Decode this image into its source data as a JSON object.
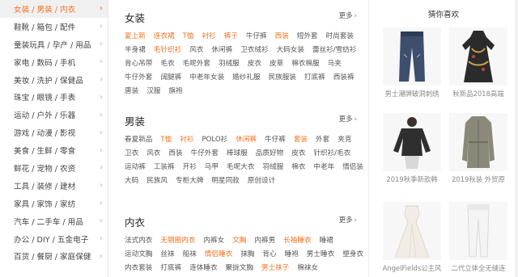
{
  "sidebar": {
    "items": [
      {
        "label": "女装 / 男装 / 内衣",
        "active": true
      },
      {
        "label": "鞋靴 / 箱包 / 配件"
      },
      {
        "label": "童装玩具 / 孕产 / 用品"
      },
      {
        "label": "家电 / 数码 / 手机"
      },
      {
        "label": "美妆 / 洗护 / 保健品"
      },
      {
        "label": "珠宝 / 眼镜 / 手表"
      },
      {
        "label": "运动 / 户外 / 乐器"
      },
      {
        "label": "游戏 / 动漫 / 影视"
      },
      {
        "label": "美食 / 生鲜 / 零食"
      },
      {
        "label": "鲜花 / 宠物 / 农资"
      },
      {
        "label": "工具 / 装修 / 建材"
      },
      {
        "label": "家具 / 家饰 / 家纺"
      },
      {
        "label": "汽车 / 二手车 / 用品"
      },
      {
        "label": "办公 / DIY / 五金电子"
      },
      {
        "label": "百货 / 餐厨 / 家庭保健"
      }
    ],
    "chevron": "›"
  },
  "sections": [
    {
      "title": "女装",
      "more": "更多",
      "tags": [
        {
          "t": "夏上新",
          "hot": true
        },
        {
          "t": "连衣裙",
          "hot": true
        },
        {
          "t": "T恤",
          "hot": true
        },
        {
          "t": "衬衫",
          "hot": true
        },
        {
          "t": "裤子",
          "hot": true
        },
        {
          "t": "牛仔裤"
        },
        {
          "t": "西装",
          "hot": true
        },
        {
          "t": "短外套"
        },
        {
          "t": "时尚套装"
        },
        {
          "t": "半身裙"
        },
        {
          "t": "毛针织衫",
          "hot": true
        },
        {
          "t": "风衣"
        },
        {
          "t": "休闲裤"
        },
        {
          "t": "卫衣绒衫"
        },
        {
          "t": "大码女装"
        },
        {
          "t": "蕾丝衫/雪纺衫"
        },
        {
          "t": "背心吊带"
        },
        {
          "t": "毛衣"
        },
        {
          "t": "毛呢外套"
        },
        {
          "t": "羽绒服"
        },
        {
          "t": "皮衣"
        },
        {
          "t": "皮草"
        },
        {
          "t": "棉衣棉服"
        },
        {
          "t": "马夹"
        },
        {
          "t": "牛仔外套"
        },
        {
          "t": "阔腿裤"
        },
        {
          "t": "中老年女装"
        },
        {
          "t": "婚纱礼服"
        },
        {
          "t": "民族服装"
        },
        {
          "t": "打底裤"
        },
        {
          "t": "西装裤"
        },
        {
          "t": "唐装"
        },
        {
          "t": "汉服"
        },
        {
          "t": "旗袍"
        }
      ]
    },
    {
      "title": "男装",
      "more": "更多",
      "tags": [
        {
          "t": "春夏新品"
        },
        {
          "t": "T恤",
          "hot": true
        },
        {
          "t": "衬衫",
          "hot": true
        },
        {
          "t": "POLO衫"
        },
        {
          "t": "休闲裤",
          "hot": true
        },
        {
          "t": "牛仔裤"
        },
        {
          "t": "套装",
          "hot": true
        },
        {
          "t": "外套"
        },
        {
          "t": "夹克"
        },
        {
          "t": "卫衣"
        },
        {
          "t": "风衣"
        },
        {
          "t": "西装"
        },
        {
          "t": "牛仔外套"
        },
        {
          "t": "棒球服"
        },
        {
          "t": "品质好物"
        },
        {
          "t": "皮衣"
        },
        {
          "t": "针织衫/毛衣"
        },
        {
          "t": "运动裤"
        },
        {
          "t": "工装裤"
        },
        {
          "t": "开衫"
        },
        {
          "t": "马甲"
        },
        {
          "t": "毛呢大衣"
        },
        {
          "t": "羽绒服"
        },
        {
          "t": "棉衣"
        },
        {
          "t": "中老年"
        },
        {
          "t": "情侣装"
        },
        {
          "t": "大码"
        },
        {
          "t": "民族风"
        },
        {
          "t": "专柜大牌"
        },
        {
          "t": "明星同款"
        },
        {
          "t": "原创设计"
        }
      ]
    },
    {
      "title": "内衣",
      "more": "更多",
      "tags": [
        {
          "t": "法式内衣"
        },
        {
          "t": "无钢圈内衣",
          "hot": true
        },
        {
          "t": "内裤女"
        },
        {
          "t": "文胸",
          "hot": true
        },
        {
          "t": "内裤男"
        },
        {
          "t": "长袖睡衣",
          "hot": true
        },
        {
          "t": "睡裙"
        },
        {
          "t": "运动文胸"
        },
        {
          "t": "丝袜"
        },
        {
          "t": "船袜"
        },
        {
          "t": "情侣睡衣",
          "hot": true
        },
        {
          "t": "抹胸"
        },
        {
          "t": "背心"
        },
        {
          "t": "睡袍"
        },
        {
          "t": "男士睡衣"
        },
        {
          "t": "塑身衣"
        },
        {
          "t": "内衣套装"
        },
        {
          "t": "打底裤"
        },
        {
          "t": "连体睡衣"
        },
        {
          "t": "聚拢文胸"
        },
        {
          "t": "男士袜子",
          "hot": true
        },
        {
          "t": "棉袜女"
        }
      ]
    }
  ],
  "recommend": {
    "title": "猜你喜欢",
    "items": [
      {
        "caption": "男士潮牌破洞刺绣",
        "icon": "jeans-icon"
      },
      {
        "caption": "秋新品2018高端",
        "icon": "dress-icon"
      },
      {
        "caption": "2019秋季新款韩",
        "icon": "sweater-icon"
      },
      {
        "caption": "2019秋装 外贸原",
        "icon": "trenchcoat-icon"
      },
      {
        "caption": "AngelFields公主风",
        "icon": "gown-icon"
      },
      {
        "caption": "二代立体全无缝连",
        "icon": "tights-icon"
      }
    ]
  },
  "colors": {
    "accent": "#f4711e",
    "active_bg": "#f0f0f0"
  }
}
